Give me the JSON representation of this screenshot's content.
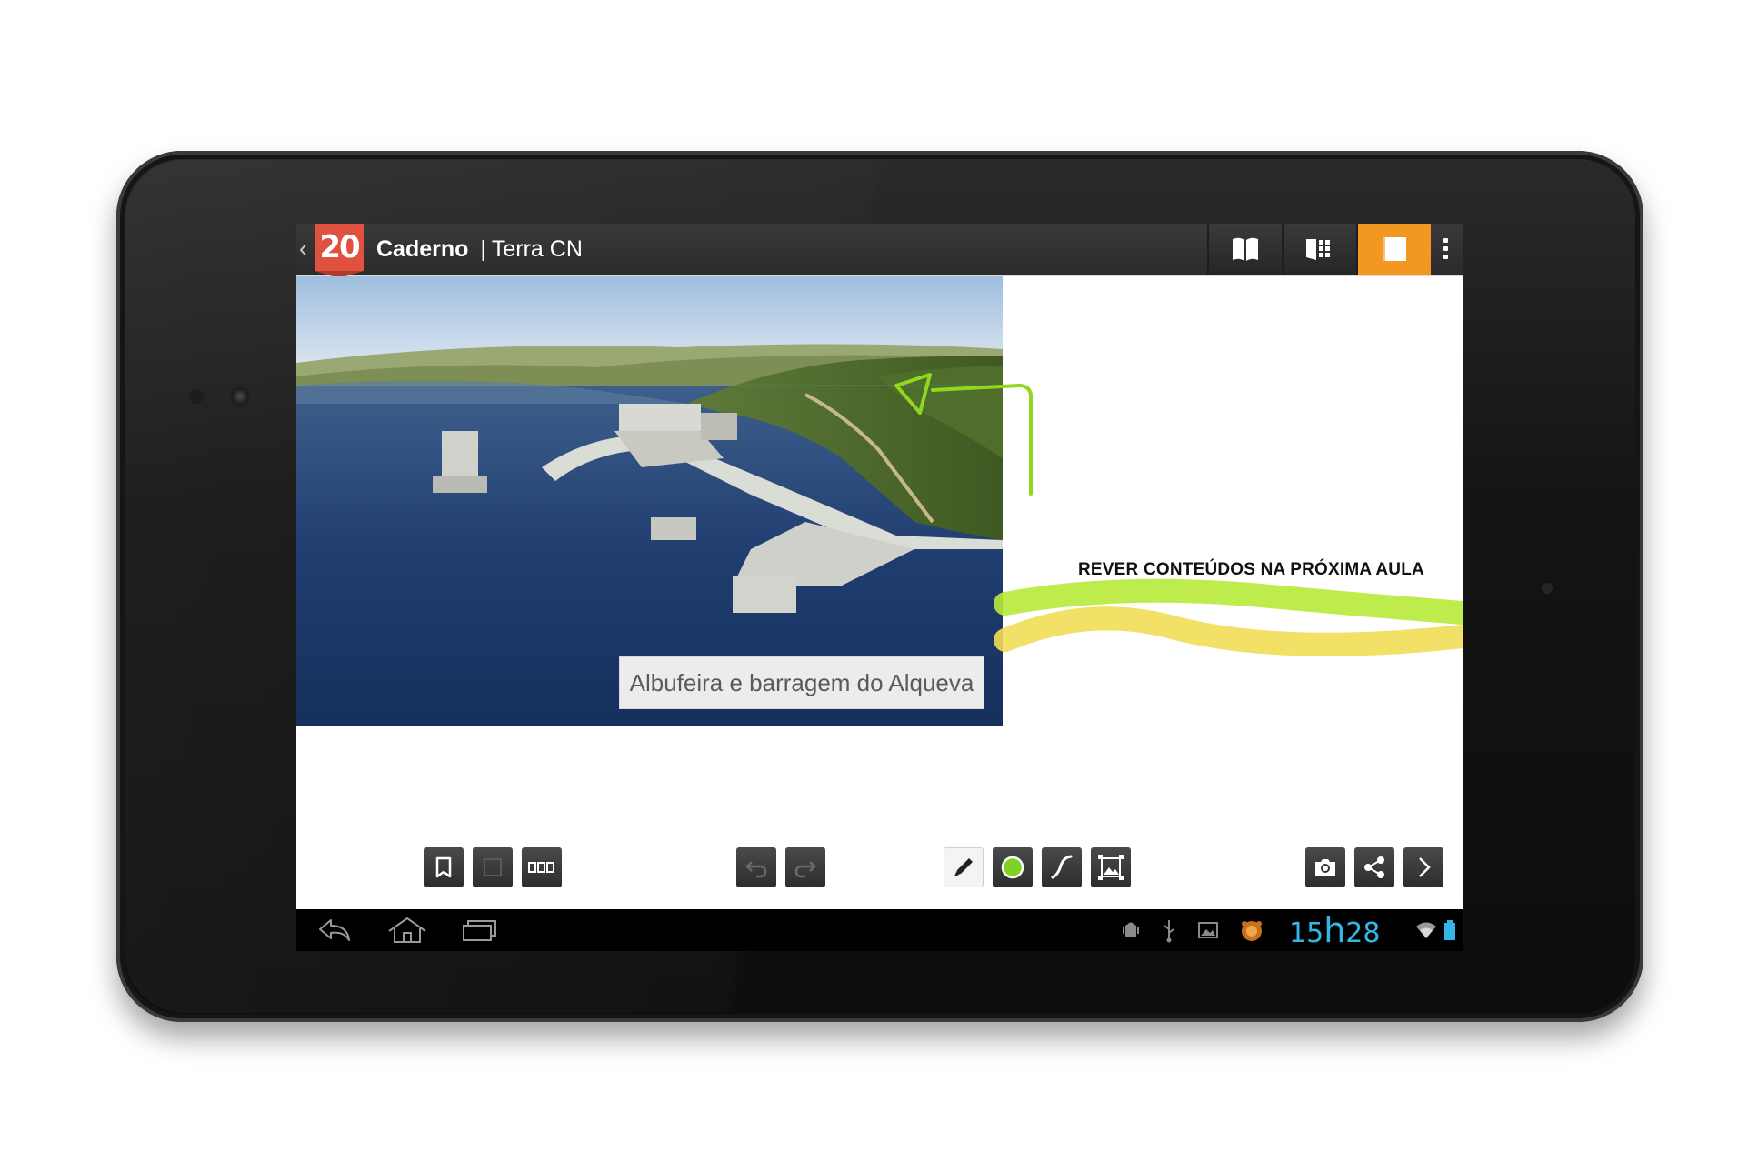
{
  "app": {
    "logo_text": "20",
    "title_bold": "Caderno",
    "title_separator": "|",
    "title_rest": "Terra CN"
  },
  "actionbar": {
    "buttons": [
      {
        "icon": "book-open-icon",
        "active": false
      },
      {
        "icon": "page-grid-icon",
        "active": false
      },
      {
        "icon": "single-page-icon",
        "active": true
      }
    ],
    "overflow_icon": "overflow-menu-icon",
    "accent_color": "#f29822"
  },
  "content": {
    "image_caption": "Albufeira e barragem do Alqueva",
    "note_text": "REVER CONTEÚDOS NA PRÓXIMA AULA",
    "ink_colors": [
      "#8fd81e",
      "#b8ea3a",
      "#f2dd55"
    ]
  },
  "toolbar": {
    "left": [
      "bookmark-icon",
      "single-view-icon",
      "multi-view-icon"
    ],
    "middle": [
      "undo-icon",
      "redo-icon"
    ],
    "drawing": [
      "pencil-icon",
      "color-picker-icon",
      "stroke-icon",
      "insert-image-icon"
    ],
    "right": [
      "camera-icon",
      "share-icon",
      "next-icon"
    ],
    "selected_color": "#7ed321"
  },
  "system_bar": {
    "clock_hours": "15",
    "clock_sep": "h",
    "clock_minutes": "28",
    "clock_color": "#33b5e5",
    "nav": [
      "back-icon",
      "home-icon",
      "recents-icon"
    ],
    "status_icons": [
      "android-debug-icon",
      "usb-icon",
      "gallery-icon",
      "app-notification-icon",
      "wifi-icon",
      "battery-icon"
    ]
  }
}
